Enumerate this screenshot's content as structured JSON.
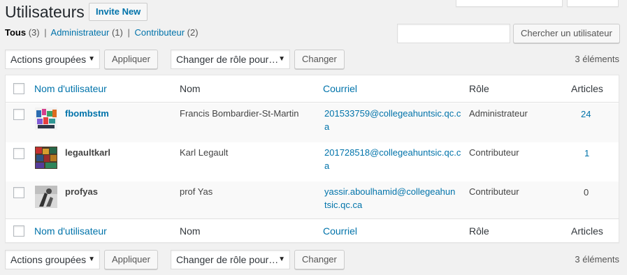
{
  "header": {
    "title": "Utilisateurs",
    "invite_label": "Invite New"
  },
  "filters": {
    "all_label": "Tous",
    "all_count": "(3)",
    "admin_label": "Administrateur",
    "admin_count": "(1)",
    "contrib_label": "Contributeur",
    "contrib_count": "(2)",
    "separator": "|"
  },
  "search": {
    "value": "",
    "button_label": "Chercher un utilisateur"
  },
  "tablenav": {
    "bulk_actions": "Actions groupées",
    "apply_label": "Appliquer",
    "change_role": "Changer de rôle pour…",
    "change_label": "Changer",
    "item_count": "3 éléments"
  },
  "table": {
    "columns": [
      "Nom d'utilisateur",
      "Nom",
      "Courriel",
      "Rôle",
      "Articles"
    ],
    "rows": [
      {
        "username": "fbombstm",
        "name": "Francis Bombardier-St-Martin",
        "email": "201533759@collegeahuntsic.qc.ca",
        "role": "Administrateur",
        "posts": "24"
      },
      {
        "username": "legaultkarl",
        "name": "Karl Legault",
        "email": "201728518@collegeahuntsic.qc.ca",
        "role": "Contributeur",
        "posts": "1"
      },
      {
        "username": "profyas",
        "name": "prof Yas",
        "email": "yassir.aboulhamid@collegeahuntsic.qc.ca",
        "role": "Contributeur",
        "posts": "0"
      }
    ]
  },
  "icons": {
    "caret": "▼"
  },
  "colors": {
    "link": "#0073aa",
    "background": "#f1f1f1"
  }
}
